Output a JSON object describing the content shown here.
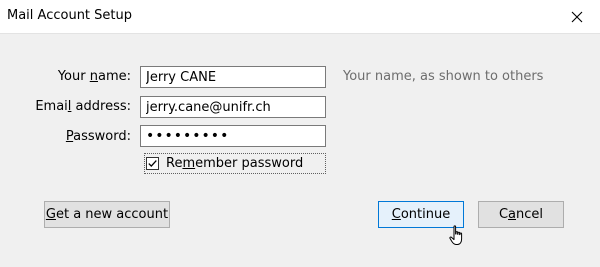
{
  "window": {
    "title": "Mail Account Setup"
  },
  "form": {
    "name": {
      "label_before": "Your ",
      "label_access": "n",
      "label_after": "ame:",
      "value": "Jerry CANE",
      "hint": "Your name, as shown to others"
    },
    "email": {
      "label_before": "Emai",
      "label_access": "l",
      "label_after": " address:",
      "value": "jerry.cane@unifr.ch"
    },
    "password": {
      "label_before": "",
      "label_access": "P",
      "label_after": "assword:",
      "value": "•••••••••"
    },
    "remember": {
      "label_before": "Re",
      "label_access": "m",
      "label_after": "ember password",
      "checked": true
    }
  },
  "buttons": {
    "get_account": {
      "label_before": "",
      "label_access": "G",
      "label_after": "et a new account"
    },
    "continue": {
      "label_before": "",
      "label_access": "C",
      "label_after": "ontinue"
    },
    "cancel": {
      "label_before": "C",
      "label_access": "a",
      "label_after": "ncel"
    }
  },
  "icons": {
    "close": "close-icon",
    "checkmark": "checkmark-icon",
    "cursor": "hand-pointer-icon"
  }
}
